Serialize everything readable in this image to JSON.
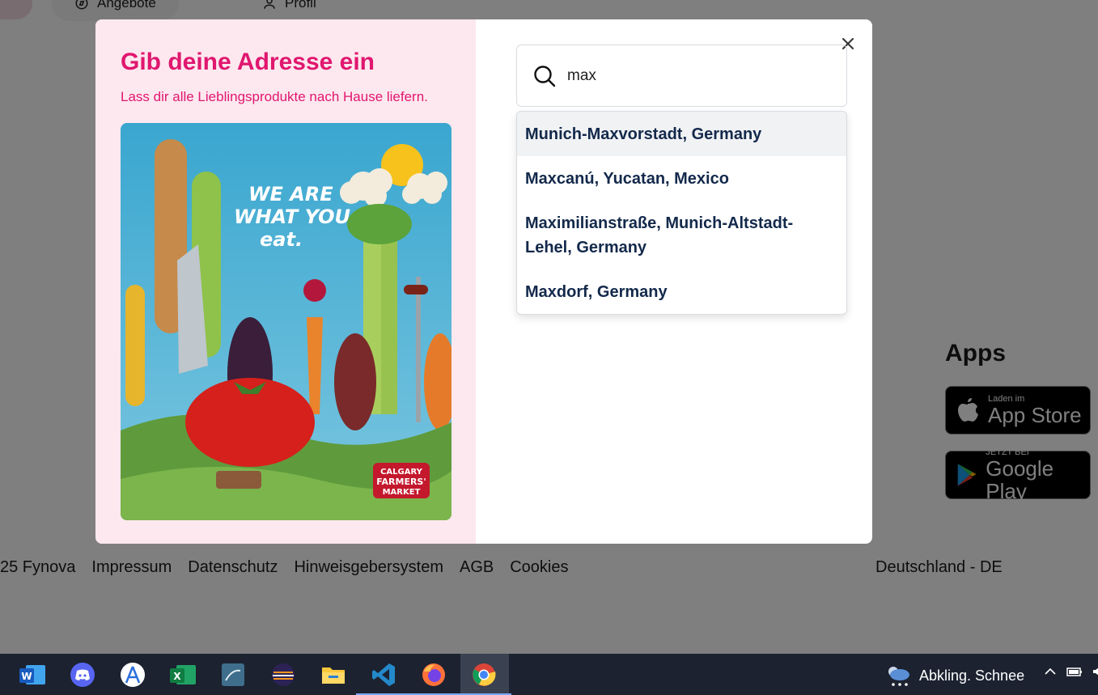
{
  "background": {
    "nav": {
      "offers_label": "Angebote",
      "profile_label": "Profil"
    },
    "apps": {
      "title": "Apps",
      "app_store": {
        "small": "Laden im",
        "big": "App Store"
      },
      "google_play": {
        "small": "JETZT BEI",
        "big": "Google Play"
      }
    },
    "footer": {
      "copyright": "25 Fynova",
      "links": [
        "Impressum",
        "Datenschutz",
        "Hinweisgebersystem",
        "AGB",
        "Cookies"
      ],
      "locale": "Deutschland - DE"
    }
  },
  "modal": {
    "title": "Gib deine Adresse ein",
    "subtitle": "Lass dir alle Lieblingsprodukte nach Hause liefern.",
    "promo": {
      "headline": [
        "WE ARE",
        "WHAT YOU",
        "eat."
      ],
      "brand": [
        "CALGARY",
        "FARMERS'",
        "MARKET"
      ]
    },
    "search": {
      "value": "max"
    },
    "suggestions": [
      "Munich-Maxvorstadt, Germany",
      "Maxcanú, Yucatan, Mexico",
      "Maximilianstraße, Munich-Altstadt-Lehel, Germany",
      "Maxdorf, Germany"
    ],
    "colors": {
      "accent": "#e0176f",
      "panel": "#fde8ef",
      "suggestion_text": "#13294b"
    }
  },
  "taskbar": {
    "apps": [
      "word-icon",
      "discord-icon",
      "app-icon",
      "excel-icon",
      "database-icon",
      "eclipse-icon",
      "file-explorer-icon",
      "vscode-icon",
      "firefox-icon",
      "chrome-icon"
    ],
    "weather": "Abkling. Schnee"
  }
}
